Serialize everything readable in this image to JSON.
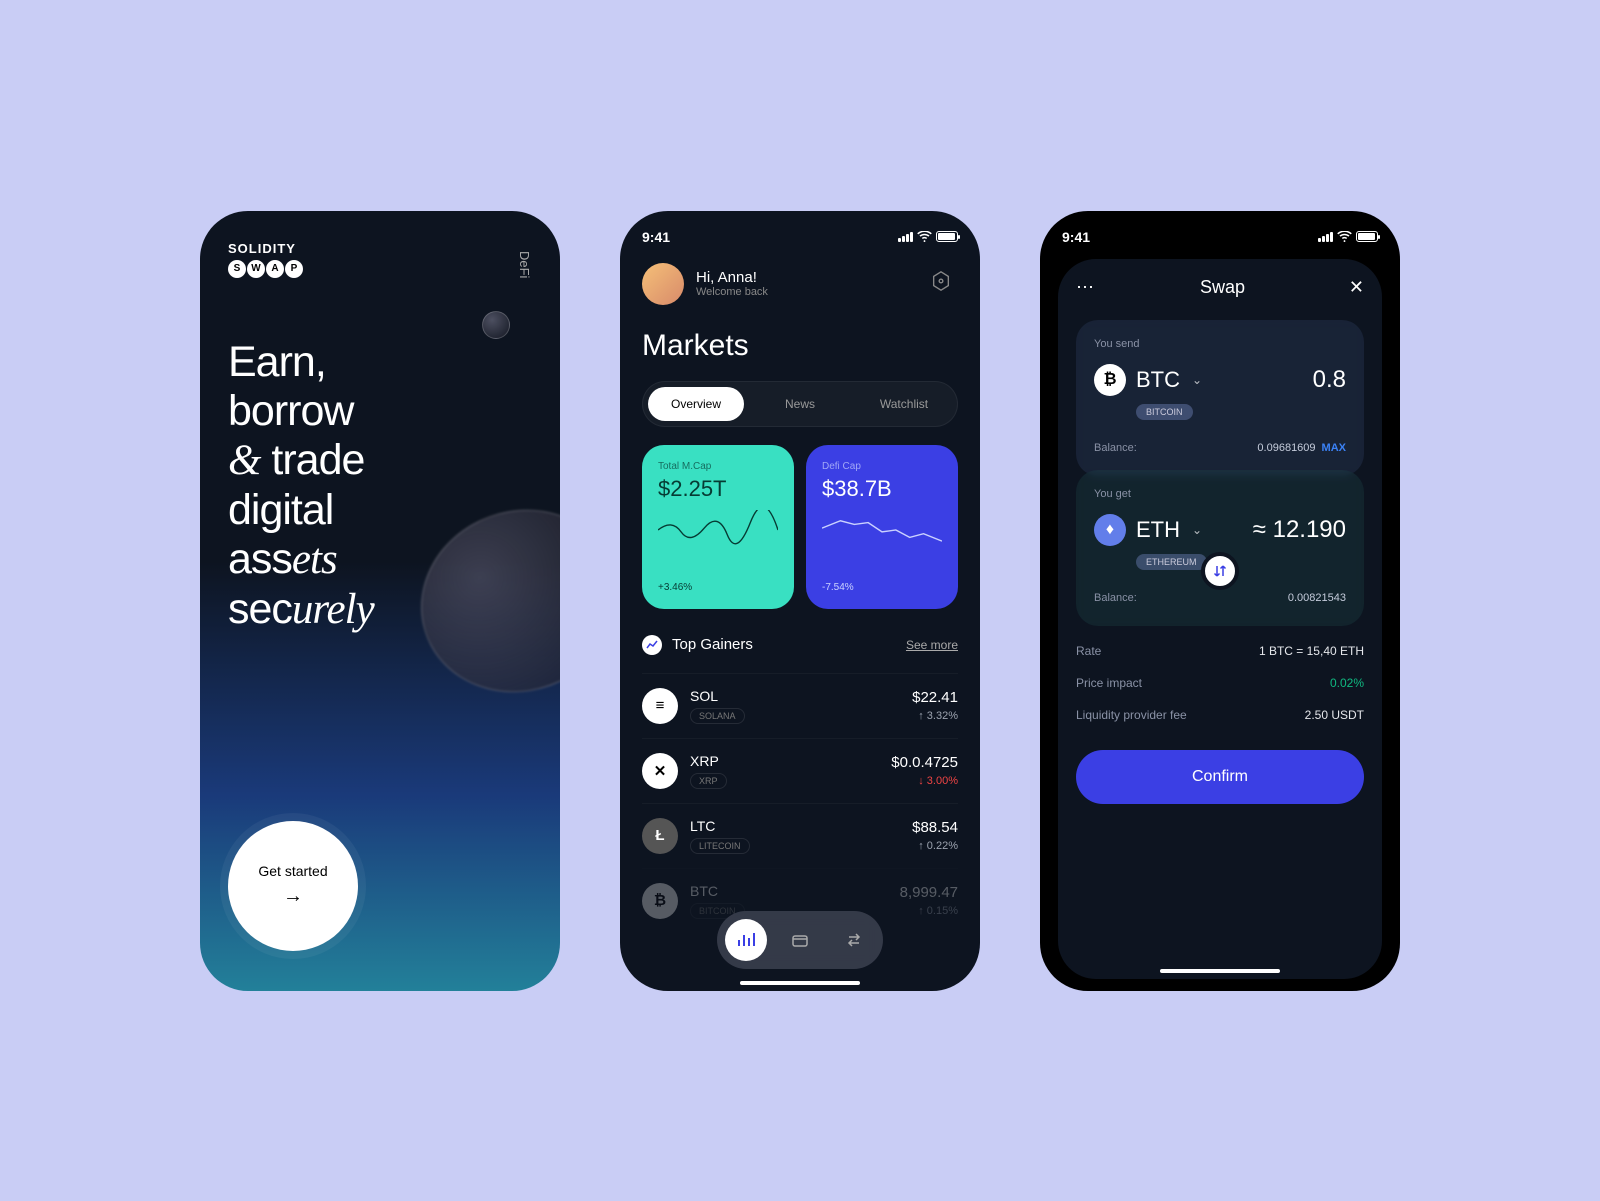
{
  "status": {
    "time": "9:41"
  },
  "phone1": {
    "brand_top": "SOLIDITY",
    "brand_letters": [
      "S",
      "W",
      "A",
      "P"
    ],
    "defi_tag": "DeFi",
    "hero_line1": "Earn,",
    "hero_line2": "borrow",
    "hero_amp": "&",
    "hero_line3": "trade",
    "hero_line4": "digital",
    "hero_line5a": "ass",
    "hero_line5b": "ets",
    "hero_line6a": "sec",
    "hero_line6b": "urely",
    "cta": "Get started"
  },
  "phone2": {
    "greeting": "Hi, Anna!",
    "welcome": "Welcome back",
    "markets_title": "Markets",
    "tabs": [
      "Overview",
      "News",
      "Watchlist"
    ],
    "cards": [
      {
        "label": "Total M.Cap",
        "value": "$2.25T",
        "change": "+3.46%"
      },
      {
        "label": "Defi Cap",
        "value": "$38.7B",
        "change": "-7.54%"
      }
    ],
    "top_gainers_title": "Top Gainers",
    "see_more": "See more",
    "coins": [
      {
        "sym": "SOL",
        "name": "SOLANA",
        "price": "$22.41",
        "change": "↑ 3.32%",
        "dir": "up"
      },
      {
        "sym": "XRP",
        "name": "XRP",
        "price": "$0.0.4725",
        "change": "↓ 3.00%",
        "dir": "down"
      },
      {
        "sym": "LTC",
        "name": "LITECOIN",
        "price": "$88.54",
        "change": "↑ 0.22%",
        "dir": "up"
      },
      {
        "sym": "BTC",
        "name": "BITCOIN",
        "price": "8,999.47",
        "change": "↑ 0.15%",
        "dir": "up"
      }
    ]
  },
  "phone3": {
    "title": "Swap",
    "send_label": "You send",
    "send_sym": "BTC",
    "send_name": "BITCOIN",
    "send_amt": "0.8",
    "send_bal_label": "Balance:",
    "send_bal": "0.09681609",
    "max": "MAX",
    "get_label": "You get",
    "get_sym": "ETH",
    "get_name": "ETHEREUM",
    "get_amt": "≈ 12.190",
    "get_bal_label": "Balance:",
    "get_bal": "0.00821543",
    "rate_label": "Rate",
    "rate_value": "1 BTC = 15,40 ETH",
    "impact_label": "Price impact",
    "impact_value": "0.02%",
    "fee_label": "Liquidity provider fee",
    "fee_value": "2.50 USDT",
    "confirm": "Confirm"
  }
}
